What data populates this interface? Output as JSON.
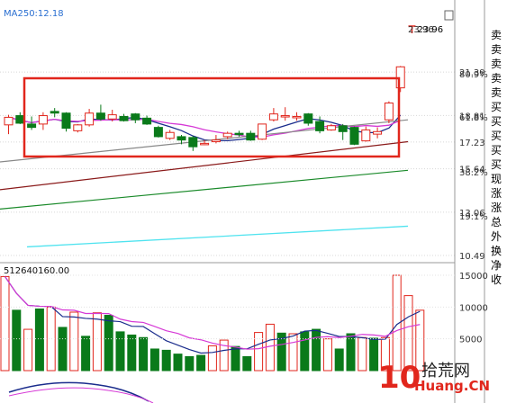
{
  "chart_data": [
    {
      "type": "candlestick",
      "indicator_label": "MA250:12.18",
      "price_axis": {
        "ticks": [
          "23.96",
          "21.39",
          "18.81",
          "17.23",
          "15.64",
          "13.06",
          "10.49"
        ],
        "percent_labels": [
          "80.9%",
          "61.8%",
          "38.2%",
          "19.1%"
        ],
        "range": [
          10.0,
          24.5
        ]
      },
      "candles": [
        {
          "o": 18.25,
          "h": 18.85,
          "l": 17.7,
          "c": 18.7
        },
        {
          "o": 18.8,
          "h": 19.0,
          "l": 18.3,
          "c": 18.35
        },
        {
          "o": 18.3,
          "h": 18.75,
          "l": 17.95,
          "c": 18.1
        },
        {
          "o": 18.3,
          "h": 19.0,
          "l": 17.95,
          "c": 18.8
        },
        {
          "o": 19.05,
          "h": 19.25,
          "l": 18.7,
          "c": 18.95
        },
        {
          "o": 18.95,
          "h": 19.0,
          "l": 17.85,
          "c": 18.05
        },
        {
          "o": 17.9,
          "h": 18.3,
          "l": 17.8,
          "c": 18.25
        },
        {
          "o": 18.25,
          "h": 19.2,
          "l": 18.15,
          "c": 18.95
        },
        {
          "o": 18.95,
          "h": 19.45,
          "l": 18.5,
          "c": 18.6
        },
        {
          "o": 18.6,
          "h": 19.15,
          "l": 18.45,
          "c": 18.85
        },
        {
          "o": 18.75,
          "h": 18.9,
          "l": 18.45,
          "c": 18.5
        },
        {
          "o": 18.9,
          "h": 18.95,
          "l": 18.35,
          "c": 18.55
        },
        {
          "o": 18.65,
          "h": 18.8,
          "l": 18.25,
          "c": 18.3
        },
        {
          "o": 18.1,
          "h": 18.2,
          "l": 17.5,
          "c": 17.55
        },
        {
          "o": 17.45,
          "h": 17.95,
          "l": 17.35,
          "c": 17.8
        },
        {
          "o": 17.55,
          "h": 17.65,
          "l": 17.1,
          "c": 17.35
        },
        {
          "o": 17.5,
          "h": 17.6,
          "l": 16.7,
          "c": 16.95
        },
        {
          "o": 17.1,
          "h": 17.35,
          "l": 17.05,
          "c": 17.15
        },
        {
          "o": 17.25,
          "h": 17.65,
          "l": 17.15,
          "c": 17.35
        },
        {
          "o": 17.55,
          "h": 17.85,
          "l": 17.4,
          "c": 17.75
        },
        {
          "o": 17.75,
          "h": 17.9,
          "l": 17.55,
          "c": 17.7
        },
        {
          "o": 17.75,
          "h": 17.9,
          "l": 17.3,
          "c": 17.35
        },
        {
          "o": 17.4,
          "h": 18.2,
          "l": 17.35,
          "c": 18.3
        },
        {
          "o": 18.55,
          "h": 19.25,
          "l": 18.45,
          "c": 18.9
        },
        {
          "o": 18.75,
          "h": 19.3,
          "l": 18.5,
          "c": 18.8
        },
        {
          "o": 18.7,
          "h": 19.0,
          "l": 18.5,
          "c": 18.75
        },
        {
          "o": 18.9,
          "h": 18.95,
          "l": 18.2,
          "c": 18.35
        },
        {
          "o": 18.45,
          "h": 18.75,
          "l": 17.75,
          "c": 17.9
        },
        {
          "o": 17.95,
          "h": 18.3,
          "l": 17.9,
          "c": 18.2
        },
        {
          "o": 18.2,
          "h": 18.3,
          "l": 17.35,
          "c": 17.85
        },
        {
          "o": 18.1,
          "h": 18.15,
          "l": 17.05,
          "c": 17.1
        },
        {
          "o": 17.3,
          "h": 18.15,
          "l": 17.25,
          "c": 17.95
        },
        {
          "o": 17.7,
          "h": 18.1,
          "l": 17.45,
          "c": 17.85
        },
        {
          "o": 18.55,
          "h": 19.65,
          "l": 18.35,
          "c": 19.55
        },
        {
          "o": 20.45,
          "h": 21.75,
          "l": 20.2,
          "c": 21.7
        },
        {
          "o": null,
          "h": 23.96,
          "l": null,
          "c": null
        }
      ],
      "volume": {
        "indicator_label": "512640160.00",
        "ticks": [
          "15000",
          "10000",
          "5000"
        ],
        "range": [
          0,
          16500
        ],
        "values": [
          14800,
          9500,
          6500,
          9700,
          10000,
          6800,
          9200,
          5400,
          9100,
          8700,
          6100,
          5600,
          5200,
          3400,
          3200,
          2600,
          2200,
          2400,
          3900,
          4800,
          3800,
          2200,
          6000,
          7300,
          5900,
          5800,
          6100,
          6500,
          5000,
          3400,
          5800,
          5200,
          5100,
          5200,
          15000,
          11800,
          9500
        ],
        "up": [
          true,
          false,
          true,
          false,
          true,
          false,
          true,
          false,
          true,
          false,
          false,
          false,
          false,
          false,
          false,
          false,
          false,
          false,
          true,
          true,
          false,
          false,
          true,
          true,
          false,
          true,
          false,
          false,
          true,
          false,
          false,
          true,
          false,
          true,
          true,
          true,
          true
        ]
      }
    }
  ],
  "side_panel": {
    "chars": [
      "卖",
      "卖",
      "卖",
      "卖",
      "卖",
      "买",
      "买",
      "买",
      "买",
      "买",
      "现",
      "涨",
      "涨",
      "总",
      "外",
      "换",
      "净",
      "收"
    ]
  },
  "watermark": {
    "num": "10",
    "cn": "拾荒网",
    "en": "Huang.CN"
  },
  "colors": {
    "up": "#e1261c",
    "down": "#0a7a1a",
    "box": "#e1261c",
    "ma5": "#1a2c8c",
    "ma10": "#d639d6",
    "ma20": "#888888",
    "ma60": "#8a1a1a",
    "ma120": "#1a8a2a",
    "ma250": "#4fe3ef",
    "axis": "#999999"
  }
}
